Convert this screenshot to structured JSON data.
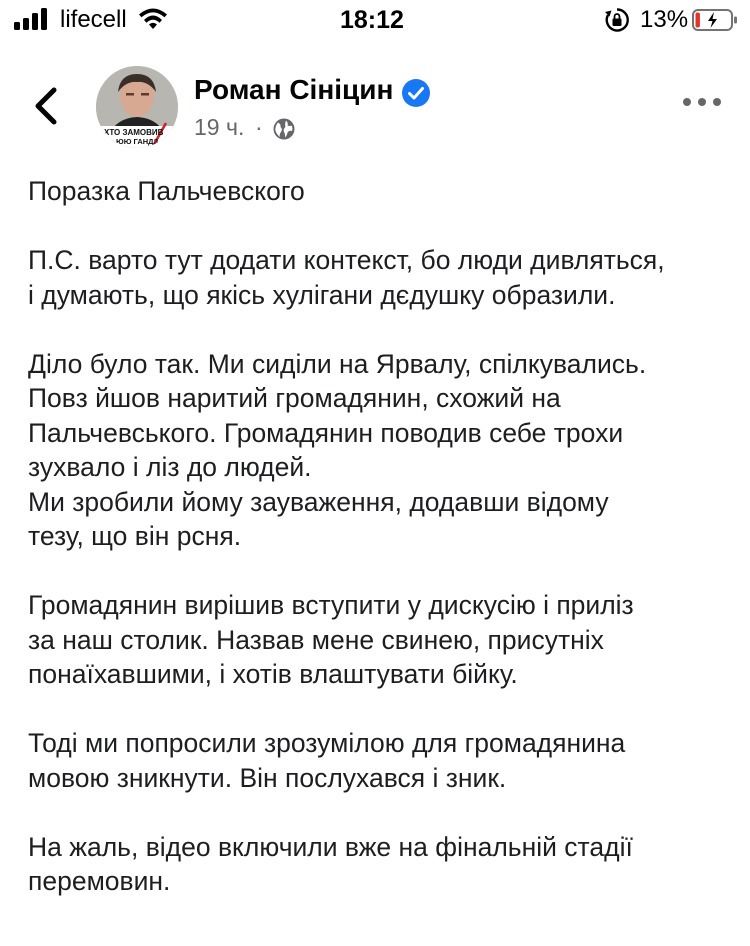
{
  "status_bar": {
    "carrier": "lifecell",
    "time": "18:12",
    "battery_percent": "13%",
    "battery_level": 0.13,
    "icons": [
      "signal-bars-icon",
      "wifi-icon",
      "orientation-lock-icon",
      "battery-low-icon"
    ]
  },
  "post": {
    "author": "Роман Сініцин",
    "time": "19 ч.",
    "separator": "·",
    "privacy_icon": "globe-icon",
    "verified_color": "#1877f2",
    "avatar_caption_1": "ХТО ЗАМОВИВ",
    "avatar_caption_2": "ЮЮ ГАНДЗ",
    "paragraphs": [
      "Поразка Пальчевского",
      "П.С. варто тут додати контекст, бо люди дивляться,\nі думають, що якісь хулігани дєдушку образили.",
      "Діло було так. Ми сиділи на Ярвалу, спілкувались.\nПовз йшов наритий громадянин, схожий на\nПальчевського. Громадянин поводив себе трохи\nзухвало і ліз до людей.\nМи зробили йому зауваження, додавши відому\nтезу, що він рсня.",
      "Громадянин вирішив вступити у дискусію і приліз\nза наш столик. Назвав мене свинею, присутніх\nпонаїхавшими, і хотів влаштувати бійку.",
      "Тоді ми попросили зрозумілою для громадянина\nмовою зникнути. Він послухався і зник.",
      "На жаль, відео включили вже на фінальній стадії\nперемовин."
    ]
  }
}
